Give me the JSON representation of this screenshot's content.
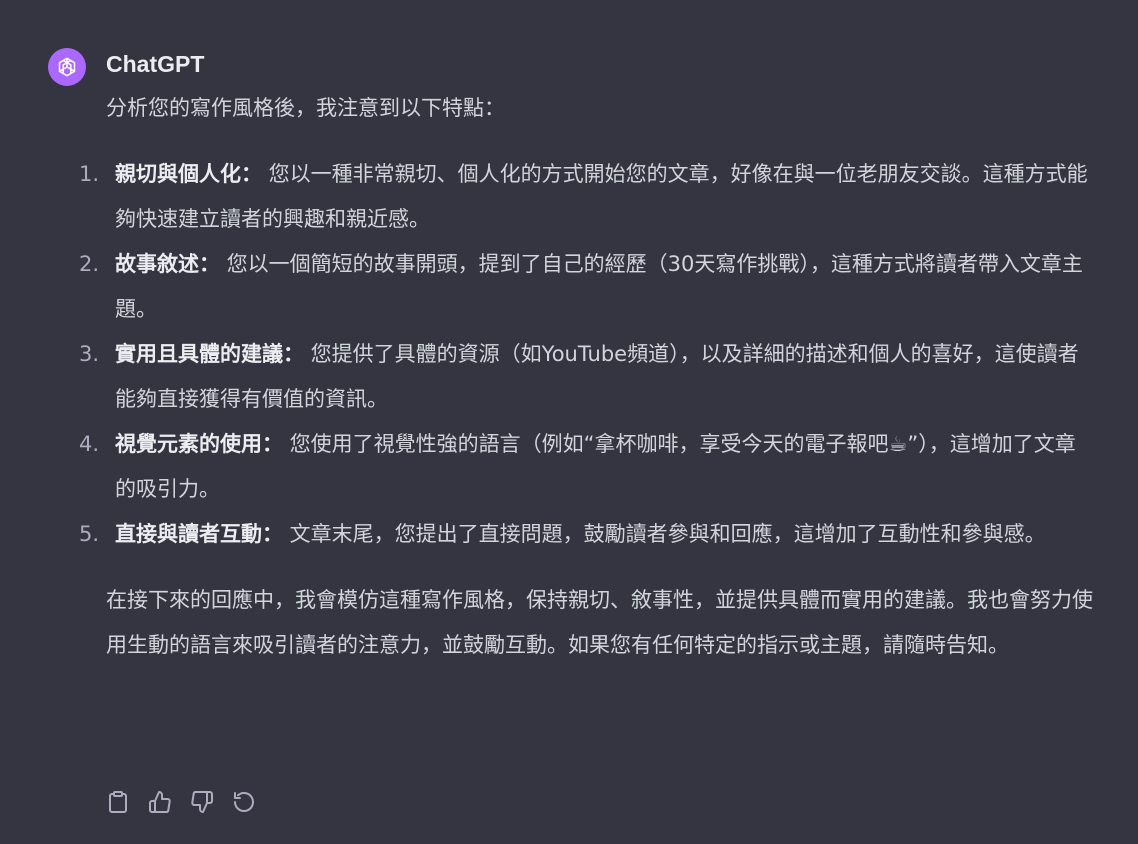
{
  "assistant": {
    "name": "ChatGPT",
    "avatar_icon": "openai-logo-icon",
    "avatar_color": "#ab68ff"
  },
  "message": {
    "intro": "分析您的寫作風格後，我注意到以下特點：",
    "points": [
      {
        "number": "1.",
        "term": "親切與個人化：",
        "text": " 您以一種非常親切、個人化的方式開始您的文章，好像在與一位老朋友交談。這種方式能夠快速建立讀者的興趣和親近感。"
      },
      {
        "number": "2.",
        "term": "故事敘述：",
        "text": " 您以一個簡短的故事開頭，提到了自己的經歷（30天寫作挑戰），這種方式將讀者帶入文章主題。"
      },
      {
        "number": "3.",
        "term": "實用且具體的建議：",
        "text": " 您提供了具體的資源（如YouTube頻道），以及詳細的描述和個人的喜好，這使讀者能夠直接獲得有價值的資訊。"
      },
      {
        "number": "4.",
        "term": "視覺元素的使用：",
        "text": " 您使用了視覺性強的語言（例如“拿杯咖啡，享受今天的電子報吧☕”），這增加了文章的吸引力。"
      },
      {
        "number": "5.",
        "term": "直接與讀者互動：",
        "text": " 文章末尾，您提出了直接問題，鼓勵讀者參與和回應，這增加了互動性和參與感。"
      }
    ],
    "conclusion": "在接下來的回應中，我會模仿這種寫作風格，保持親切、敘事性，並提供具體而實用的建議。我也會努力使用生動的語言來吸引讀者的注意力，並鼓勵互動。如果您有任何特定的指示或主題，請隨時告知。"
  },
  "actions": [
    {
      "icon": "copy-icon"
    },
    {
      "icon": "thumbs-up-icon"
    },
    {
      "icon": "thumbs-down-icon"
    },
    {
      "icon": "regenerate-icon"
    }
  ],
  "colors": {
    "background": "#343541",
    "text": "#d1d5db",
    "bold_text": "#ececf1",
    "muted": "#acacbe"
  }
}
